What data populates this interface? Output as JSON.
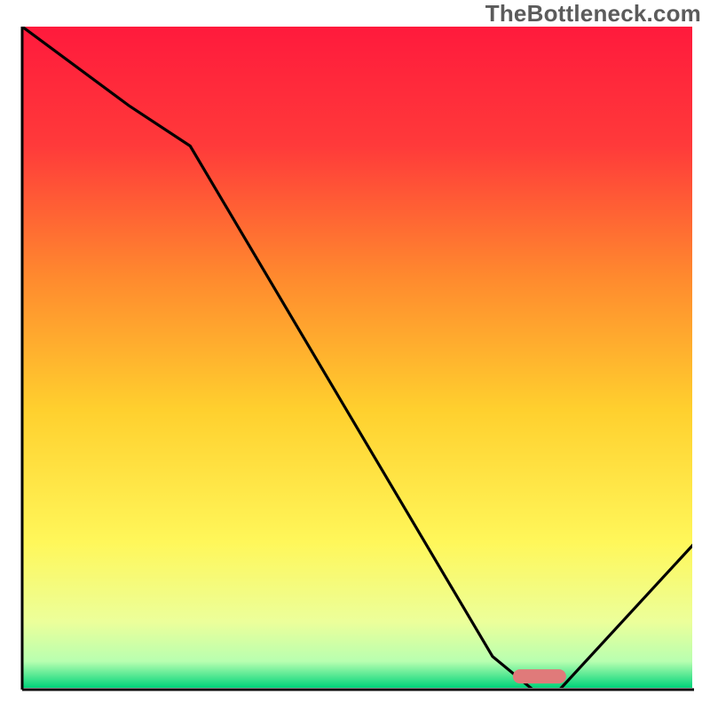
{
  "watermark": {
    "text": "TheBottleneck.com"
  },
  "chart_data": {
    "type": "line",
    "x": [
      0,
      16,
      25,
      70,
      76,
      80,
      100
    ],
    "values": [
      100,
      88,
      82,
      5,
      0,
      0,
      22
    ],
    "title": "",
    "xlabel": "",
    "ylabel": "",
    "xlim": [
      0,
      100
    ],
    "ylim": [
      0,
      100
    ],
    "grid": false,
    "background_gradient": {
      "top": "#ff1a3c",
      "upper": "#ff6a2e",
      "mid": "#ffd02e",
      "lower": "#fff75a",
      "base": "#ecff9a",
      "bottom": "#00d47a"
    },
    "annotation": {
      "type": "pill",
      "x": 77,
      "y": 2,
      "color": "#e07a7a"
    }
  }
}
